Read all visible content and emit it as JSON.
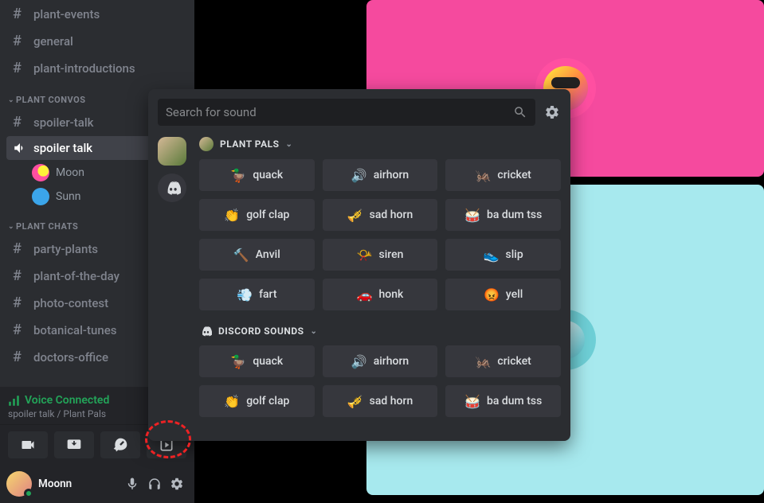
{
  "sidebar": {
    "channels_top": [
      {
        "name": "plant-events"
      },
      {
        "name": "general"
      },
      {
        "name": "plant-introductions"
      }
    ],
    "cat_convos": "PLANT CONVOS",
    "channels_convos": [
      {
        "name": "spoiler-talk",
        "type": "text"
      }
    ],
    "voice_channel": "spoiler talk",
    "voice_users": [
      {
        "name": "Moon"
      },
      {
        "name": "Sunn"
      }
    ],
    "cat_chats": "PLANT CHATS",
    "channels_chats": [
      {
        "name": "party-plants"
      },
      {
        "name": "plant-of-the-day"
      },
      {
        "name": "photo-contest"
      },
      {
        "name": "botanical-tunes"
      },
      {
        "name": "doctors-office"
      }
    ]
  },
  "voice_status": {
    "title": "Voice Connected",
    "subtitle": "spoiler talk / Plant Pals"
  },
  "user": {
    "name": "Moonn"
  },
  "soundboard": {
    "search_placeholder": "Search for sound",
    "groups": [
      {
        "title": "PLANT PALS",
        "icon": "plant",
        "sounds": [
          {
            "emoji": "🦆",
            "label": "quack"
          },
          {
            "emoji": "🔊",
            "label": "airhorn"
          },
          {
            "emoji": "🦗",
            "label": "cricket"
          },
          {
            "emoji": "👏",
            "label": "golf clap"
          },
          {
            "emoji": "🎺",
            "label": "sad horn"
          },
          {
            "emoji": "🥁",
            "label": "ba dum tss"
          },
          {
            "emoji": "🔨",
            "label": "Anvil"
          },
          {
            "emoji": "📯",
            "label": "siren"
          },
          {
            "emoji": "👟",
            "label": "slip"
          },
          {
            "emoji": "💨",
            "label": "fart"
          },
          {
            "emoji": "🚗",
            "label": "honk"
          },
          {
            "emoji": "😡",
            "label": "yell"
          }
        ]
      },
      {
        "title": "DISCORD SOUNDS",
        "icon": "discord",
        "sounds": [
          {
            "emoji": "🦆",
            "label": "quack"
          },
          {
            "emoji": "🔊",
            "label": "airhorn"
          },
          {
            "emoji": "🦗",
            "label": "cricket"
          },
          {
            "emoji": "👏",
            "label": "golf clap"
          },
          {
            "emoji": "🎺",
            "label": "sad horn"
          },
          {
            "emoji": "🥁",
            "label": "ba dum tss"
          }
        ]
      }
    ]
  }
}
